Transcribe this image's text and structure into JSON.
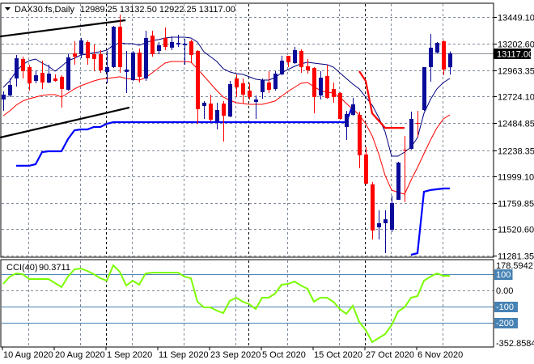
{
  "header": {
    "symbol": "DAX30.fs,Daily",
    "ohlc": "12989.25 13132.50 12922.25 13117.00"
  },
  "colors": {
    "bull": "#0b0b9a",
    "bear": "#ff0000",
    "ma_upper": "#000080",
    "ma_lower": "#ff0000",
    "support": "#0000ff",
    "resistance": "#ff0000",
    "cci": "#7cfc00",
    "cci_level": "#4682b4",
    "grid": "#7f8a99"
  },
  "chart_data": [
    {
      "type": "candlestick",
      "title": "DAX30.fs,Daily",
      "ylim": [
        11281.35,
        13449.1
      ],
      "y_ticks": [
        "13449.10",
        "13202.60",
        "12963.35",
        "12724.10",
        "12484.85",
        "12238.35",
        "11999.10",
        "11759.85",
        "11520.60",
        "11281.35"
      ],
      "y_tick_values": [
        13449.1,
        13202.6,
        12963.35,
        12724.1,
        12484.85,
        12238.35,
        11999.1,
        11759.85,
        11520.6,
        11281.35
      ],
      "current_price": 13117.0,
      "current_price_label": "13117.00",
      "x_labels": [
        {
          "bar": 0,
          "text": "10 Aug 2020"
        },
        {
          "bar": 8,
          "text": "20 Aug 2020"
        },
        {
          "bar": 16,
          "text": "1 Sep 2020"
        },
        {
          "bar": 24,
          "text": "11 Sep 2020"
        },
        {
          "bar": 32,
          "text": "23 Sep 2020"
        },
        {
          "bar": 40,
          "text": "5 Oct 2020"
        },
        {
          "bar": 48,
          "text": "15 Oct 2020"
        },
        {
          "bar": 56,
          "text": "27 Oct 2020"
        },
        {
          "bar": 64,
          "text": "6 Nov 2020"
        }
      ],
      "grid_bars": [
        4,
        12,
        20,
        28,
        36,
        44,
        52,
        60,
        68
      ],
      "month_separators": [
        16,
        38,
        56
      ],
      "candles_ohlc": [
        [
          12697,
          12771,
          12594,
          12741
        ],
        [
          12734,
          12888,
          12719,
          12829
        ],
        [
          12888,
          13101,
          12815,
          13071
        ],
        [
          13064,
          13086,
          12888,
          12954
        ],
        [
          12991,
          13013,
          12778,
          12844
        ],
        [
          12866,
          12961,
          12844,
          12917
        ],
        [
          12939,
          13049,
          12792,
          12851
        ],
        [
          12851,
          13013,
          12844,
          12932
        ],
        [
          12888,
          12925,
          12859,
          12866
        ],
        [
          12903,
          12917,
          12624,
          12792
        ],
        [
          12785,
          13108,
          12778,
          13079
        ],
        [
          13115,
          13225,
          13013,
          13086
        ],
        [
          13108,
          13255,
          13071,
          13233
        ],
        [
          13218,
          13233,
          13013,
          13071
        ],
        [
          13108,
          13196,
          12954,
          13064
        ],
        [
          13108,
          13145,
          12939,
          12961
        ],
        [
          12947,
          13137,
          12844,
          12991
        ],
        [
          12991,
          13365,
          12983,
          13357
        ],
        [
          13357,
          13467,
          12939,
          12991
        ],
        [
          12947,
          13137,
          12756,
          12969
        ],
        [
          12873,
          13137,
          12866,
          13123
        ],
        [
          13123,
          13159,
          12851,
          12903
        ],
        [
          12888,
          13321,
          12866,
          13255
        ],
        [
          13277,
          13321,
          13086,
          13108
        ],
        [
          13137,
          13218,
          13108,
          13189
        ],
        [
          13255,
          13350,
          13145,
          13174
        ],
        [
          13167,
          13269,
          13145,
          13218
        ],
        [
          13196,
          13284,
          13174,
          13211
        ],
        [
          13189,
          13247,
          13013,
          13203
        ],
        [
          13225,
          13240,
          13027,
          13101
        ],
        [
          13137,
          13145,
          12477,
          12609
        ],
        [
          12638,
          12683,
          12521,
          12668
        ],
        [
          12660,
          12741,
          12499,
          12514
        ],
        [
          12499,
          12668,
          12426,
          12602
        ],
        [
          12660,
          12683,
          12316,
          12550
        ],
        [
          12543,
          12866,
          12536,
          12837
        ],
        [
          12888,
          12925,
          12719,
          12807
        ],
        [
          12844,
          12888,
          12660,
          12741
        ],
        [
          12778,
          12844,
          12697,
          12719
        ],
        [
          12675,
          12734,
          12521,
          12697
        ],
        [
          12763,
          12888,
          12704,
          12873
        ],
        [
          12851,
          12954,
          12756,
          12785
        ],
        [
          12792,
          12954,
          12778,
          12932
        ],
        [
          12925,
          13093,
          12917,
          13049
        ],
        [
          13093,
          13093,
          12991,
          13035
        ],
        [
          13027,
          13174,
          13020,
          13145
        ],
        [
          13137,
          13152,
          12939,
          12991
        ],
        [
          12998,
          13064,
          12932,
          12961
        ],
        [
          12983,
          12991,
          12572,
          12719
        ],
        [
          12734,
          12954,
          12697,
          12895
        ],
        [
          12910,
          13013,
          12704,
          12712
        ],
        [
          12792,
          12851,
          12668,
          12719
        ],
        [
          12756,
          12763,
          12514,
          12521
        ],
        [
          12448,
          12594,
          12330,
          12565
        ],
        [
          12558,
          12712,
          12550,
          12653
        ],
        [
          12558,
          12587,
          12074,
          12191
        ],
        [
          12198,
          12264,
          11927,
          11934
        ],
        [
          11927,
          11949,
          11428,
          11509
        ],
        [
          11538,
          11692,
          11428,
          11575
        ],
        [
          11575,
          11692,
          11303,
          11611
        ],
        [
          11516,
          11824,
          11494,
          11758
        ],
        [
          11787,
          12132,
          11787,
          12125
        ],
        [
          12242,
          12367,
          11766,
          12235
        ],
        [
          12250,
          12587,
          12242,
          12521
        ],
        [
          12484,
          12594,
          12352,
          12477
        ],
        [
          12602,
          12991,
          12594,
          12991
        ],
        [
          12991,
          13291,
          12859,
          13167
        ],
        [
          13123,
          13218,
          13115,
          13211
        ],
        [
          13225,
          13233,
          12917,
          12969
        ],
        [
          12989.25,
          13132.5,
          12922.25,
          13117.0
        ]
      ],
      "series": [
        {
          "name": "upper-average",
          "values": [
            12807,
            12866,
            12954,
            13013,
            13049,
            13064,
            13027,
            12998,
            12954,
            12998,
            13049,
            13071,
            13101,
            13108,
            13123,
            13130,
            13145,
            13189,
            13211,
            13203,
            13203,
            13189,
            13211,
            13233,
            13240,
            13255,
            13262,
            13262,
            13262,
            13255,
            13218,
            13130,
            13086,
            13042,
            12976,
            12947,
            12932,
            12925,
            12903,
            12881,
            12873,
            12873,
            12895,
            12939,
            12969,
            12998,
            13020,
            13035,
            13027,
            13020,
            13013,
            12991,
            12939,
            12888,
            12837,
            12793,
            12719,
            12646,
            12536,
            12404,
            12184,
            12184,
            12220,
            12264,
            12352,
            12572,
            12697,
            12793,
            12851,
            12888
          ]
        },
        {
          "name": "lower-average",
          "values": [
            12550,
            12594,
            12646,
            12683,
            12704,
            12719,
            12734,
            12741,
            12741,
            12719,
            12756,
            12793,
            12822,
            12844,
            12866,
            12881,
            12888,
            12895,
            12903,
            12888,
            12881,
            12873,
            12895,
            12939,
            12983,
            13027,
            13042,
            13042,
            13042,
            13035,
            12976,
            12910,
            12844,
            12778,
            12719,
            12690,
            12668,
            12661,
            12653,
            12653,
            12653,
            12668,
            12683,
            12727,
            12771,
            12807,
            12844,
            12851,
            12815,
            12778,
            12763,
            12756,
            12719,
            12661,
            12609,
            12558,
            12477,
            12367,
            12206,
            12008,
            11876,
            11854,
            11839,
            11964,
            12081,
            12206,
            12330,
            12440,
            12521,
            12558
          ]
        },
        {
          "name": "support-step",
          "values": [
            null,
            null,
            12096,
            12096,
            12096,
            12110,
            12220,
            12228,
            12228,
            12228,
            12338,
            12418,
            12426,
            12426,
            12448,
            12448,
            12477,
            12492,
            12492,
            12492,
            12492,
            12492,
            12492,
            12492,
            12492,
            12492,
            12492,
            12492,
            12492,
            12492,
            12492,
            12492,
            12492,
            12492,
            12492,
            12492,
            12492,
            12492,
            12492,
            12492,
            12492,
            12492,
            12492,
            12492,
            12492,
            12492,
            12492,
            12492,
            12492,
            12492,
            12492,
            12492,
            12492,
            12492,
            12646,
            null,
            null,
            null,
            null,
            null,
            null,
            null,
            null,
            11289,
            11303,
            11861,
            11876,
            11883,
            11890,
            11890
          ]
        },
        {
          "name": "resistance-step",
          "values": [
            null,
            null,
            null,
            null,
            null,
            null,
            null,
            null,
            null,
            null,
            null,
            null,
            null,
            null,
            null,
            null,
            null,
            null,
            null,
            null,
            null,
            null,
            null,
            null,
            null,
            null,
            null,
            null,
            null,
            null,
            null,
            null,
            null,
            null,
            null,
            null,
            null,
            null,
            null,
            null,
            null,
            null,
            null,
            null,
            null,
            null,
            null,
            null,
            null,
            null,
            null,
            null,
            null,
            null,
            null,
            12954,
            12866,
            12572,
            12506,
            12440,
            12440,
            12440,
            12440,
            null,
            null,
            null,
            null,
            null,
            null,
            null
          ]
        }
      ],
      "trendlines": [
        {
          "name": "upper-channel",
          "from": [
            -0.5,
            13269
          ],
          "to": [
            18.9,
            13416
          ]
        },
        {
          "name": "lower-channel",
          "from": [
            -0.5,
            12352
          ],
          "to": [
            19.5,
            12624
          ]
        }
      ]
    },
    {
      "type": "line",
      "title": "CCI(40)",
      "value_label": "90.3711",
      "ylim": [
        -352.8584,
        178.5942
      ],
      "y_ticks": [
        {
          "value": 178.5942,
          "text": "178.5942",
          "boxed": false
        },
        {
          "value": 100,
          "text": "100",
          "boxed": true
        },
        {
          "value": 0,
          "text": "0.00",
          "boxed": false
        },
        {
          "value": -100,
          "text": "-100",
          "boxed": true
        },
        {
          "value": -200,
          "text": "-200",
          "boxed": true
        },
        {
          "value": -352.8584,
          "text": "-352.8584",
          "boxed": false
        }
      ],
      "levels": [
        100,
        -100,
        -200
      ],
      "values": [
        40,
        85,
        105,
        100,
        70,
        70,
        70,
        70,
        45,
        20,
        85,
        130,
        135,
        120,
        100,
        75,
        60,
        155,
        115,
        30,
        60,
        35,
        105,
        110,
        110,
        110,
        110,
        110,
        85,
        75,
        -70,
        -105,
        -105,
        -125,
        -140,
        -65,
        -45,
        -70,
        -85,
        -115,
        -45,
        -45,
        -20,
        35,
        40,
        55,
        30,
        10,
        -70,
        -45,
        -45,
        -70,
        -115,
        -145,
        -95,
        -195,
        -245,
        -320,
        -295,
        -270,
        -215,
        -130,
        -105,
        -45,
        -35,
        60,
        85,
        105,
        90,
        90.3711
      ]
    }
  ]
}
